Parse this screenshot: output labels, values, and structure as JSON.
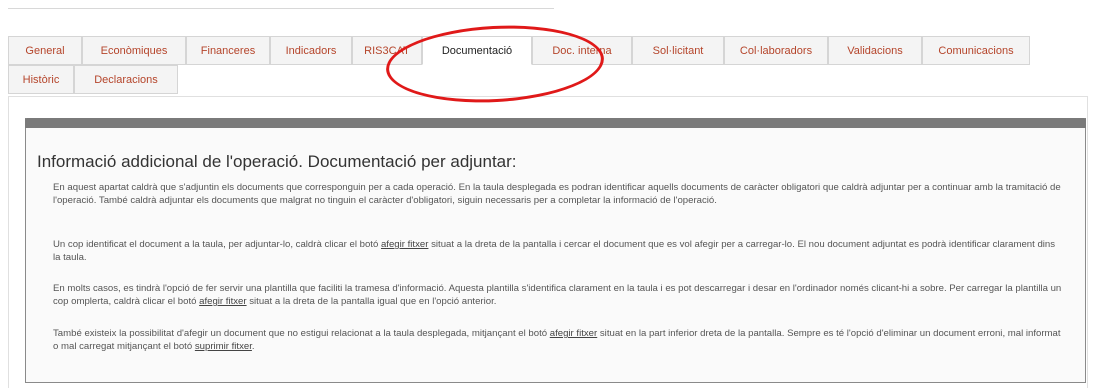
{
  "tabs": [
    {
      "label": "General"
    },
    {
      "label": "Econòmiques"
    },
    {
      "label": "Financeres"
    },
    {
      "label": "Indicadors"
    },
    {
      "label": "RIS3CAT"
    },
    {
      "label": "Documentació"
    },
    {
      "label": "Doc. interna"
    },
    {
      "label": "Sol·licitant"
    },
    {
      "label": "Col·laboradors"
    },
    {
      "label": "Validacions"
    },
    {
      "label": "Comunicacions"
    },
    {
      "label": "Històric"
    },
    {
      "label": "Declaracions"
    }
  ],
  "active_tab": "Documentació",
  "section": {
    "title": "Informació addicional de l'operació. Documentació per adjuntar:",
    "p1": "En aquest apartat caldrà que s'adjuntin els documents que corresponguin per a cada operació. En la taula desplegada es podran identificar aquells documents de caràcter obligatori que caldrà adjuntar per a continuar amb la tramitació de l'operació. També caldrà adjuntar els documents que malgrat no tinguin el caràcter d'obligatori, siguin necessaris per a completar la informació de l'operació.",
    "p2_a": "Un cop identificat el document a la taula, per adjuntar-lo, caldrà clicar el botó ",
    "p2_link": "afegir fitxer",
    "p2_b": " situat a la dreta de la pantalla i cercar el document que es vol afegir per a carregar-lo. El nou document adjuntat es podrà identificar clarament dins la taula.",
    "p3_a": "En molts casos, es tindrà l'opció de fer servir una plantilla que faciliti la tramesa d'informació. Aquesta plantilla s'identifica clarament en la taula i es pot descarregar i desar en l'ordinador només clicant-hi a sobre. Per carregar la plantilla un cop omplerta, caldrà clicar el botó ",
    "p3_link": "afegir fitxer",
    "p3_b": " situat a la dreta de la pantalla igual que en l'opció anterior.",
    "p4_a": "També existeix la possibilitat d'afegir un document que no estigui relacionat a la taula desplegada, mitjançant el botó ",
    "p4_link1": "afegir fitxer",
    "p4_b": " situat en la part inferior dreta de la pantalla. Sempre es té l'opció d'eliminar un document erroni, mal informat o mal carregat mitjançant el botó ",
    "p4_link2": "suprimir fitxer",
    "p4_c": "."
  },
  "colors": {
    "tab_text": "#b5452b",
    "highlight_circle": "#e01919",
    "box_header": "#7a7a7a"
  }
}
